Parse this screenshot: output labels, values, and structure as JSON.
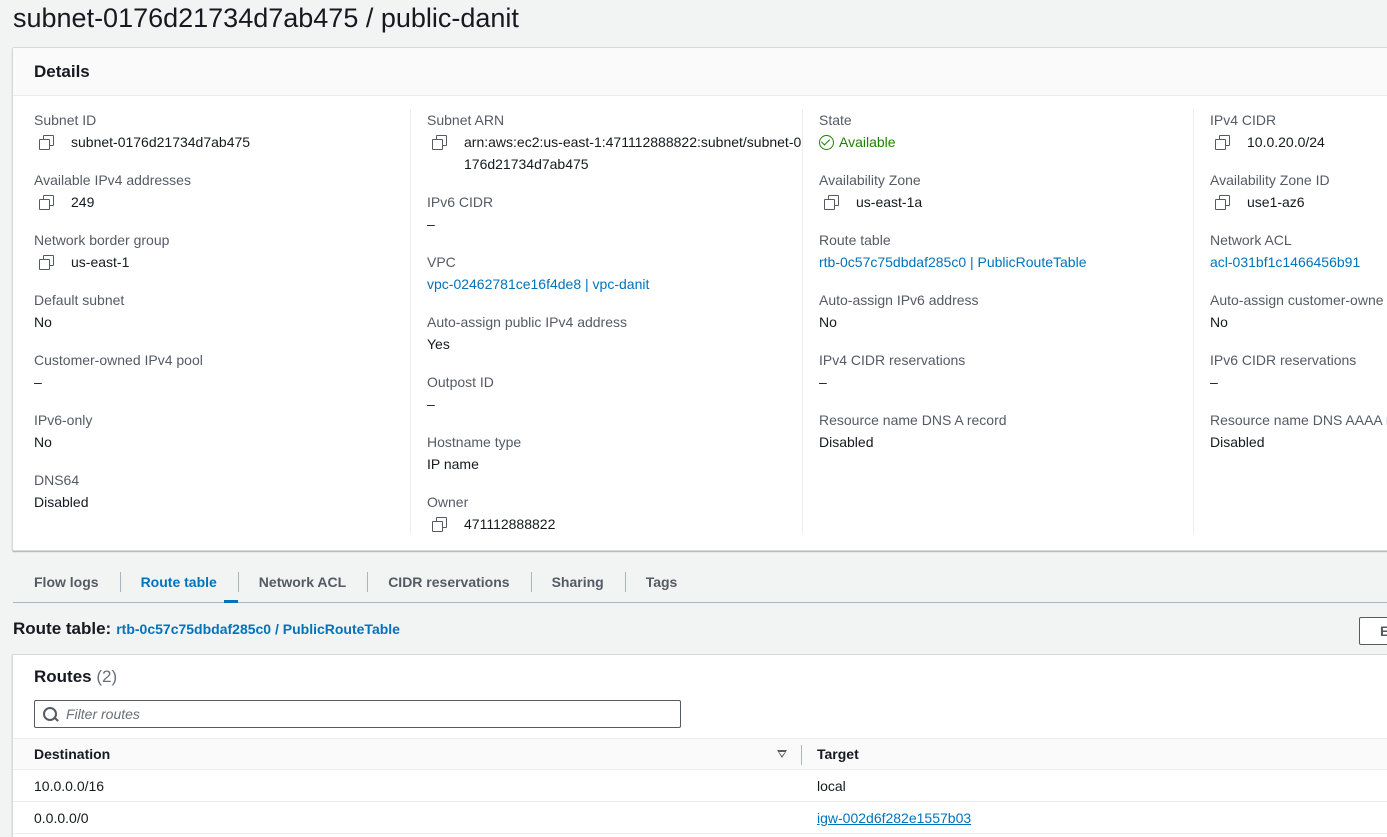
{
  "page": {
    "title": "subnet-0176d21734d7ab475 / public-danit"
  },
  "details": {
    "heading": "Details",
    "col0": [
      {
        "label": "Subnet ID",
        "value": "subnet-0176d21734d7ab475",
        "copy": true
      },
      {
        "label": "Available IPv4 addresses",
        "value": "249",
        "copy": true
      },
      {
        "label": "Network border group",
        "value": "us-east-1",
        "copy": true
      },
      {
        "label": "Default subnet",
        "value": "No"
      },
      {
        "label": "Customer-owned IPv4 pool",
        "value": "–"
      },
      {
        "label": "IPv6-only",
        "value": "No"
      },
      {
        "label": "DNS64",
        "value": "Disabled"
      }
    ],
    "col1": [
      {
        "label": "Subnet ARN",
        "value": "arn:aws:ec2:us-east-1:471112888822:subnet/subnet-0176d21734d7ab475",
        "copy": true
      },
      {
        "label": "IPv6 CIDR",
        "value": "–"
      },
      {
        "label": "VPC",
        "value": "vpc-02462781ce16f4de8 | vpc-danit",
        "link": true
      },
      {
        "label": "Auto-assign public IPv4 address",
        "value": "Yes"
      },
      {
        "label": "Outpost ID",
        "value": "–"
      },
      {
        "label": "Hostname type",
        "value": "IP name"
      },
      {
        "label": "Owner",
        "value": "471112888822",
        "copy": true
      }
    ],
    "col2": [
      {
        "label": "State",
        "value": "Available",
        "status": "ok"
      },
      {
        "label": "Availability Zone",
        "value": "us-east-1a",
        "copy": true
      },
      {
        "label": "Route table",
        "value": "rtb-0c57c75dbdaf285c0 | PublicRouteTable",
        "link": true
      },
      {
        "label": "Auto-assign IPv6 address",
        "value": "No"
      },
      {
        "label": "IPv4 CIDR reservations",
        "value": "–"
      },
      {
        "label": "Resource name DNS A record",
        "value": "Disabled"
      }
    ],
    "col3": [
      {
        "label": "IPv4 CIDR",
        "value": "10.0.20.0/24",
        "copy": true
      },
      {
        "label": "Availability Zone ID",
        "value": "use1-az6",
        "copy": true
      },
      {
        "label": "Network ACL",
        "value": "acl-031bf1c1466456b91",
        "link": true
      },
      {
        "label": "Auto-assign customer-owne",
        "value": "No"
      },
      {
        "label": "IPv6 CIDR reservations",
        "value": "–"
      },
      {
        "label": "Resource name DNS AAAA r",
        "value": "Disabled"
      }
    ]
  },
  "tabs": [
    {
      "label": "Flow logs",
      "active": false
    },
    {
      "label": "Route table",
      "active": true
    },
    {
      "label": "Network ACL",
      "active": false
    },
    {
      "label": "CIDR reservations",
      "active": false
    },
    {
      "label": "Sharing",
      "active": false
    },
    {
      "label": "Tags",
      "active": false
    }
  ],
  "route_table": {
    "label": "Route table:",
    "link": "rtb-0c57c75dbdaf285c0 / PublicRouteTable",
    "edit_button": "E"
  },
  "routes": {
    "title": "Routes",
    "count": "(2)",
    "filter_placeholder": "Filter routes",
    "columns": {
      "destination": "Destination",
      "target": "Target"
    },
    "rows": [
      {
        "destination": "10.0.0.0/16",
        "target": "local",
        "target_link": false
      },
      {
        "destination": "0.0.0.0/0",
        "target": "igw-002d6f282e1557b03",
        "target_link": true
      }
    ]
  },
  "colors": {
    "link": "#0073bb",
    "ok": "#1d8102",
    "label": "#545b64"
  }
}
